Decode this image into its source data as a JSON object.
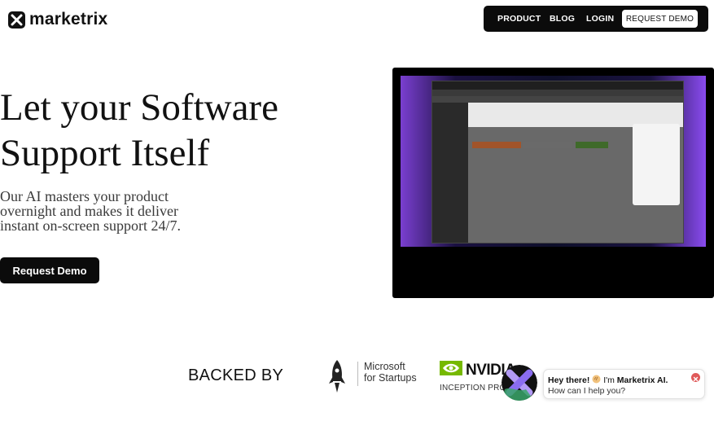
{
  "brand": {
    "name": "marketrix",
    "logo_icon": "x-logo-icon"
  },
  "nav": {
    "items": [
      "PRODUCT",
      "BLOG",
      "LOGIN"
    ],
    "cta_label": "REQUEST DEMO"
  },
  "hero": {
    "headline_line1": "Let your Software",
    "headline_line2": "Support Itself",
    "subtitle_line1": "Our AI masters your product",
    "subtitle_line2": "overnight and makes it deliver",
    "subtitle_line3": "instant on-screen support 24/7.",
    "cta_label": "Request Demo"
  },
  "demo_video": {
    "icon": "product-demo-screenshot"
  },
  "backers": {
    "heading": "BACKED BY",
    "microsoft": {
      "line1": "Microsoft",
      "line2": "for Startups",
      "icon": "rocket-icon"
    },
    "nvidia": {
      "word": "NVIDIA",
      "sub": "INCEPTION PROG",
      "icon": "nvidia-eye-icon"
    }
  },
  "chat_widget": {
    "greeting_bold": "Hey there!",
    "greeting_rest": " I'm ",
    "brand_bold": "Marketrix AI.",
    "question": "How can I help you?",
    "icon": "close-icon"
  },
  "colors": {
    "dark": "#0b0b0b",
    "accent_purple": "#7a3fd0",
    "accent_green": "#76b900",
    "close_red": "#e05a5a"
  }
}
